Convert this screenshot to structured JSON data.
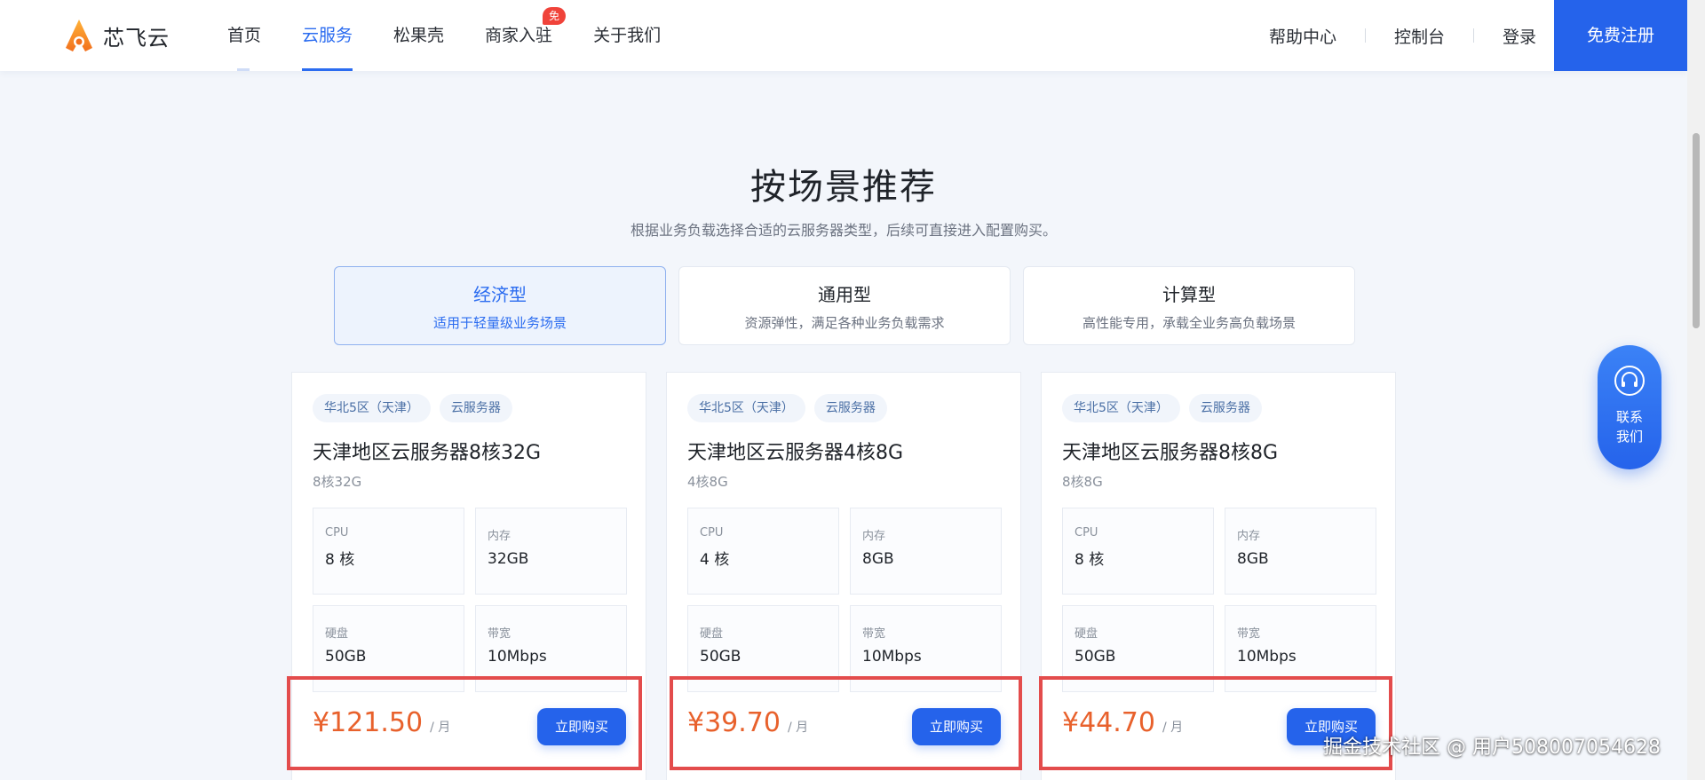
{
  "brand": {
    "name": "芯飞云"
  },
  "nav": {
    "items": [
      {
        "label": "首页"
      },
      {
        "label": "云服务"
      },
      {
        "label": "松果壳"
      },
      {
        "label": "商家入驻",
        "badge": "免费"
      },
      {
        "label": "关于我们"
      }
    ],
    "active_index": 1
  },
  "header_right": {
    "help": "帮助中心",
    "console": "控制台",
    "login": "登录",
    "signup": "免费注册"
  },
  "section": {
    "title": "按场景推荐",
    "subtitle": "根据业务负载选择合适的云服务器类型，后续可直接进入配置购买。"
  },
  "tabs": [
    {
      "name": "经济型",
      "desc": "适用于轻量级业务场景",
      "active": true
    },
    {
      "name": "通用型",
      "desc": "资源弹性，满足各种业务负载需求",
      "active": false
    },
    {
      "name": "计算型",
      "desc": "高性能专用，承载全业务高负载场景",
      "active": false
    }
  ],
  "cards": [
    {
      "tags": [
        "华北5区（天津）",
        "云服务器"
      ],
      "title": "天津地区云服务器8核32G",
      "subtitle": "8核32G",
      "specs": [
        {
          "label": "CPU",
          "value": "8 核"
        },
        {
          "label": "内存",
          "value": "32GB"
        },
        {
          "label": "硬盘",
          "value": "50GB"
        },
        {
          "label": "带宽",
          "value": "10Mbps"
        }
      ],
      "price": "¥121.50",
      "unit": "/ 月",
      "buy_label": "立即购买"
    },
    {
      "tags": [
        "华北5区（天津）",
        "云服务器"
      ],
      "title": "天津地区云服务器4核8G",
      "subtitle": "4核8G",
      "specs": [
        {
          "label": "CPU",
          "value": "4 核"
        },
        {
          "label": "内存",
          "value": "8GB"
        },
        {
          "label": "硬盘",
          "value": "50GB"
        },
        {
          "label": "带宽",
          "value": "10Mbps"
        }
      ],
      "price": "¥39.70",
      "unit": "/ 月",
      "buy_label": "立即购买"
    },
    {
      "tags": [
        "华北5区（天津）",
        "云服务器"
      ],
      "title": "天津地区云服务器8核8G",
      "subtitle": "8核8G",
      "specs": [
        {
          "label": "CPU",
          "value": "8 核"
        },
        {
          "label": "内存",
          "value": "8GB"
        },
        {
          "label": "硬盘",
          "value": "50GB"
        },
        {
          "label": "带宽",
          "value": "10Mbps"
        }
      ],
      "price": "¥44.70",
      "unit": "/ 月",
      "buy_label": "立即购买"
    }
  ],
  "contact": {
    "label": "联系\n我们",
    "icon": "headset-icon"
  },
  "watermark": "掘金技术社区 @ 用户508007054628",
  "colors": {
    "primary": "#2563eb",
    "price": "#e8612c",
    "highlight": "#e34c4c",
    "badge": "#f0433a"
  }
}
